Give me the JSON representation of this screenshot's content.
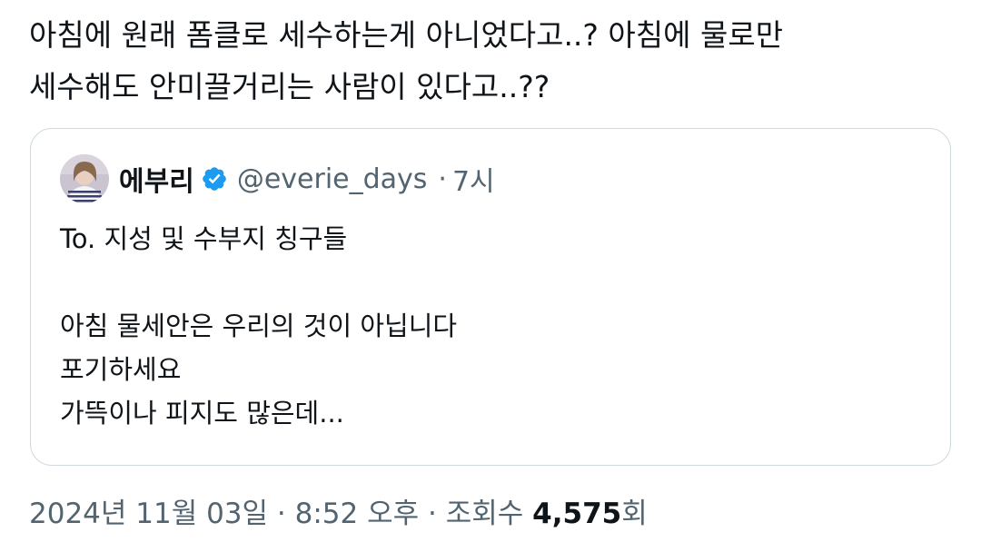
{
  "tweet": {
    "text_lines": [
      "아침에 원래 폼클로 세수하는게 아니었다고..? 아침에 물로만",
      "세수해도 안미끌거리는 사람이 있다고..??"
    ]
  },
  "quoted_tweet": {
    "display_name": "에부리",
    "verified": true,
    "handle": "@everie_days",
    "separator": "·",
    "time": "7시",
    "body_lines": [
      "To. 지성 및 수부지 칭구들",
      "",
      "아침 물세안은 우리의 것이 아닙니다",
      "포기하세요",
      "가뜩이나 피지도 많은데..."
    ]
  },
  "meta": {
    "date": "2024년 11월 03일",
    "sep1": "·",
    "time": "8:52 오후",
    "sep2": "·",
    "views_label": "조회수",
    "views_count": "4,575",
    "views_suffix": "회"
  },
  "colors": {
    "text_primary": "#0f1419",
    "text_secondary": "#536471",
    "border": "#cfd9de",
    "verified_blue": "#1d9bf0"
  },
  "icons": {
    "verified": "verified-badge-icon",
    "avatar": "user-avatar-photo"
  }
}
